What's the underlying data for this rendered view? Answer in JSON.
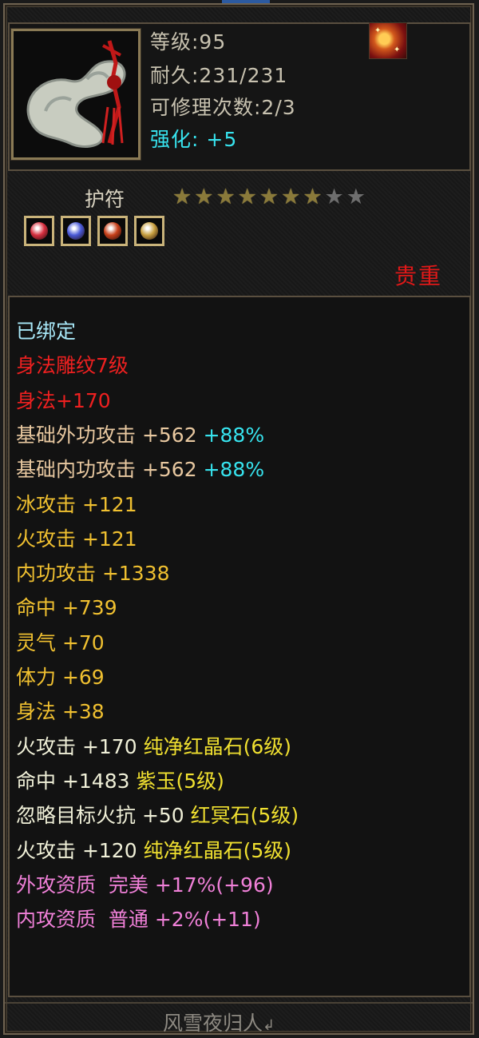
{
  "item": {
    "level_text": "等级:95",
    "durability_text": "耐久:231/231",
    "repair_text": "可修理次数:2/3",
    "enhance_label": "强化:",
    "enhance_value": "+5",
    "type": "护符",
    "stars_filled": 7,
    "stars_total": 9,
    "rarity": "贵重",
    "icon": "jade-amulet-icon",
    "corner_icon": "fire-emblem-icon",
    "gems": [
      {
        "icon": "red-gem-icon",
        "color": "#d83040"
      },
      {
        "icon": "blue-gem-icon",
        "color": "#4a5ad8"
      },
      {
        "icon": "red-crystal-icon",
        "color": "#c8401a"
      },
      {
        "icon": "rainbow-gem-icon",
        "color": "#c8a040"
      }
    ]
  },
  "attributes": [
    {
      "parts": [
        {
          "text": "已绑定",
          "color": "#a8e8f8"
        }
      ]
    },
    {
      "parts": [
        {
          "text": "身法雕纹7级",
          "color": "#ee2020"
        }
      ]
    },
    {
      "parts": [
        {
          "text": "身法+170",
          "color": "#ee2020"
        }
      ]
    },
    {
      "parts": [
        {
          "text": "基础外功攻击 +562",
          "color": "#e8c8a0"
        },
        {
          "text": " +88%",
          "color": "#37e3ee"
        }
      ]
    },
    {
      "parts": [
        {
          "text": "基础内功攻击 +562",
          "color": "#e8c8a0"
        },
        {
          "text": " +88%",
          "color": "#37e3ee"
        }
      ]
    },
    {
      "parts": [
        {
          "text": "冰攻击 +121",
          "color": "#f0c030"
        }
      ]
    },
    {
      "parts": [
        {
          "text": "火攻击 +121",
          "color": "#f0c030"
        }
      ]
    },
    {
      "parts": [
        {
          "text": "内功攻击 +1338",
          "color": "#f0c030"
        }
      ]
    },
    {
      "parts": [
        {
          "text": "命中 +739",
          "color": "#f0c030"
        }
      ]
    },
    {
      "parts": [
        {
          "text": "灵气 +70",
          "color": "#f0c030"
        }
      ]
    },
    {
      "parts": [
        {
          "text": "体力 +69",
          "color": "#f0c030"
        }
      ]
    },
    {
      "parts": [
        {
          "text": "身法 +38",
          "color": "#f0c030"
        }
      ]
    },
    {
      "parts": [
        {
          "text": "火攻击 +170 ",
          "color": "#f0f0d8"
        },
        {
          "text": "纯净红晶石(6级)",
          "color": "#f0e030"
        }
      ]
    },
    {
      "parts": [
        {
          "text": "命中 +1483 ",
          "color": "#f0f0d8"
        },
        {
          "text": "紫玉(5级)",
          "color": "#f0e030"
        }
      ]
    },
    {
      "parts": [
        {
          "text": "忽略目标火抗 +50 ",
          "color": "#f0f0d8"
        },
        {
          "text": "红冥石(5级)",
          "color": "#f0e030"
        }
      ]
    },
    {
      "parts": [
        {
          "text": "火攻击 +120 ",
          "color": "#f0f0d8"
        },
        {
          "text": "纯净红晶石(5级)",
          "color": "#f0e030"
        }
      ]
    },
    {
      "parts": [
        {
          "text": "外攻资质  完美 +17%(+96)",
          "color": "#f080d8"
        }
      ]
    },
    {
      "parts": [
        {
          "text": "内攻资质  普通 +2%(+11)",
          "color": "#f080d8"
        }
      ]
    }
  ],
  "footer": "风雪夜归人"
}
